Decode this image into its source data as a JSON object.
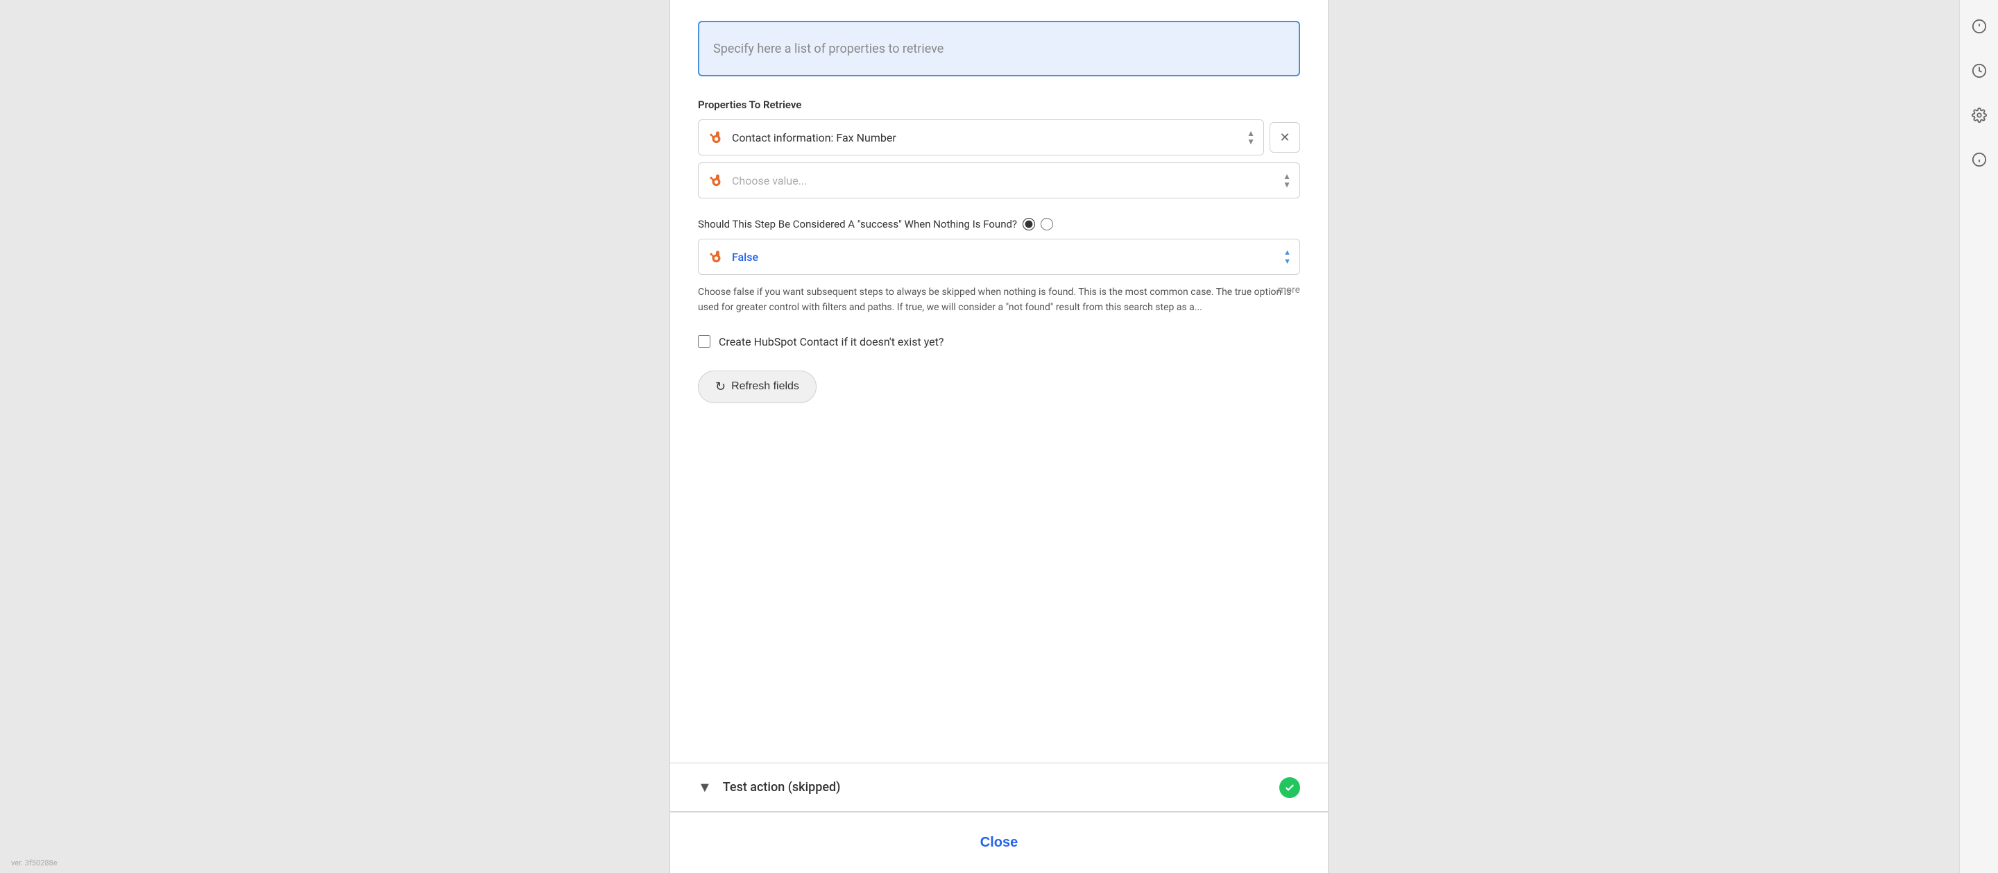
{
  "version": "ver. 3f50288e",
  "sidebar": {
    "icons": [
      {
        "name": "alert-circle-icon",
        "symbol": "!"
      },
      {
        "name": "clock-icon",
        "symbol": "🕐"
      },
      {
        "name": "gear-icon",
        "symbol": "⚙"
      },
      {
        "name": "info-icon",
        "symbol": "ℹ"
      }
    ]
  },
  "modal": {
    "text_area_placeholder": "Specify here a list of properties to retrieve",
    "properties_section": {
      "label": "Properties To Retrieve",
      "selected_value": "Contact information: Fax Number",
      "choose_placeholder": "Choose value...",
      "remove_button_label": "✕"
    },
    "success_section": {
      "label": "Should This Step Be Considered A \"success\" When Nothing Is Found?",
      "radio1_checked": true,
      "radio2_checked": false,
      "false_value": "False",
      "description": "Choose false if you want subsequent steps to always be skipped when nothing is found. This is the most common case. The true option is used for greater control with filters and paths. If true, we will consider a \"not found\" result from this search step as a...",
      "more_link": "more"
    },
    "checkbox_section": {
      "label": "Create HubSpot Contact if it doesn't exist yet?",
      "checked": false
    },
    "refresh_button": "Refresh fields",
    "test_action": {
      "label": "Test action (skipped)",
      "status": "success"
    },
    "close_button": "Close"
  }
}
